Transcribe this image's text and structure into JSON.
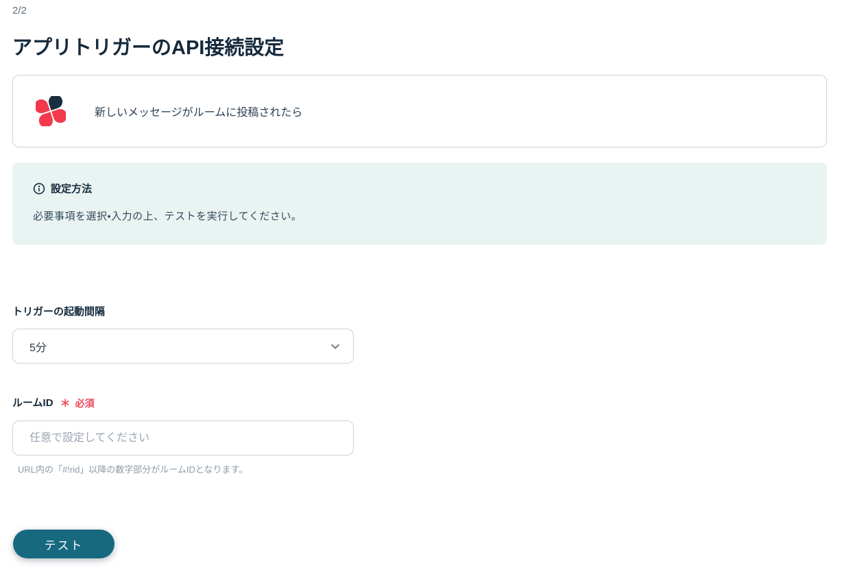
{
  "page": {
    "step_indicator": "2/2",
    "title": "アプリトリガーのAPI接続設定"
  },
  "trigger_card": {
    "app_icon_name": "chatwork-flower-icon",
    "label": "新しいメッセージがルームに投稿されたら"
  },
  "info_box": {
    "icon_name": "info-circle-icon",
    "heading": "設定方法",
    "body": "必要事項を選択・入力の上、テストを実行してください。"
  },
  "form": {
    "interval_field": {
      "label": "トリガーの起動間隔",
      "selected_value": "5分",
      "chevron_icon_name": "chevron-down-icon"
    },
    "room_id_field": {
      "label": "ルームID",
      "required_asterisk": "＊",
      "required_badge": "必須",
      "value": "",
      "placeholder": "任意で設定してください",
      "help_text": "URL内の「#!rid」以降の数字部分がルームIDとなります。"
    }
  },
  "actions": {
    "test_button_label": "テスト"
  },
  "colors": {
    "brand_red": "#f23a4c",
    "brand_navy": "#1a2e42",
    "accent_teal": "#17697f",
    "info_box_bg": "#e9f4f2",
    "required_red": "#ef4458"
  }
}
